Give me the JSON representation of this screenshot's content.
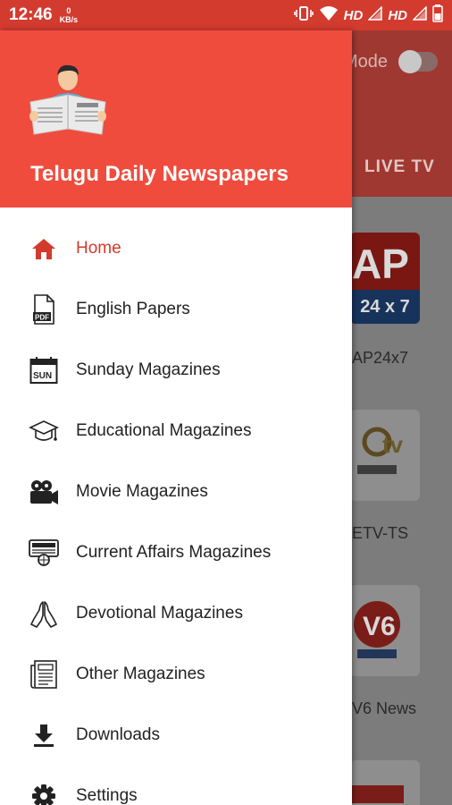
{
  "status_bar": {
    "time": "12:46",
    "speed_value": "0",
    "speed_unit": "KB/s",
    "network_1": "HD",
    "network_2": "HD"
  },
  "background_app": {
    "mode_label": "Mode",
    "tab_label": "LIVE TV",
    "channels": [
      {
        "logo_text": "AP",
        "logo_sub": "24 x 7",
        "name": "AP24x7"
      },
      {
        "name": "ETV-TS"
      },
      {
        "name": "V6 News"
      }
    ]
  },
  "drawer": {
    "title": "Telugu Daily Newspapers",
    "header_color": "#f04c3e",
    "accent_color": "#d23a2c",
    "items": [
      {
        "label": "Home",
        "icon": "home-icon",
        "active": true
      },
      {
        "label": "English Papers",
        "icon": "pdf-document-icon",
        "active": false
      },
      {
        "label": "Sunday Magazines",
        "icon": "sun-calendar-icon",
        "active": false
      },
      {
        "label": "Educational Magazines",
        "icon": "graduation-cap-icon",
        "active": false
      },
      {
        "label": "Movie Magazines",
        "icon": "movie-camera-icon",
        "active": false
      },
      {
        "label": "Current Affairs Magazines",
        "icon": "current-affairs-icon",
        "active": false
      },
      {
        "label": "Devotional Magazines",
        "icon": "praying-hands-icon",
        "active": false
      },
      {
        "label": "Other Magazines",
        "icon": "newspaper-icon",
        "active": false
      },
      {
        "label": "Downloads",
        "icon": "download-icon",
        "active": false
      },
      {
        "label": "Settings",
        "icon": "gear-icon",
        "active": false
      }
    ]
  }
}
